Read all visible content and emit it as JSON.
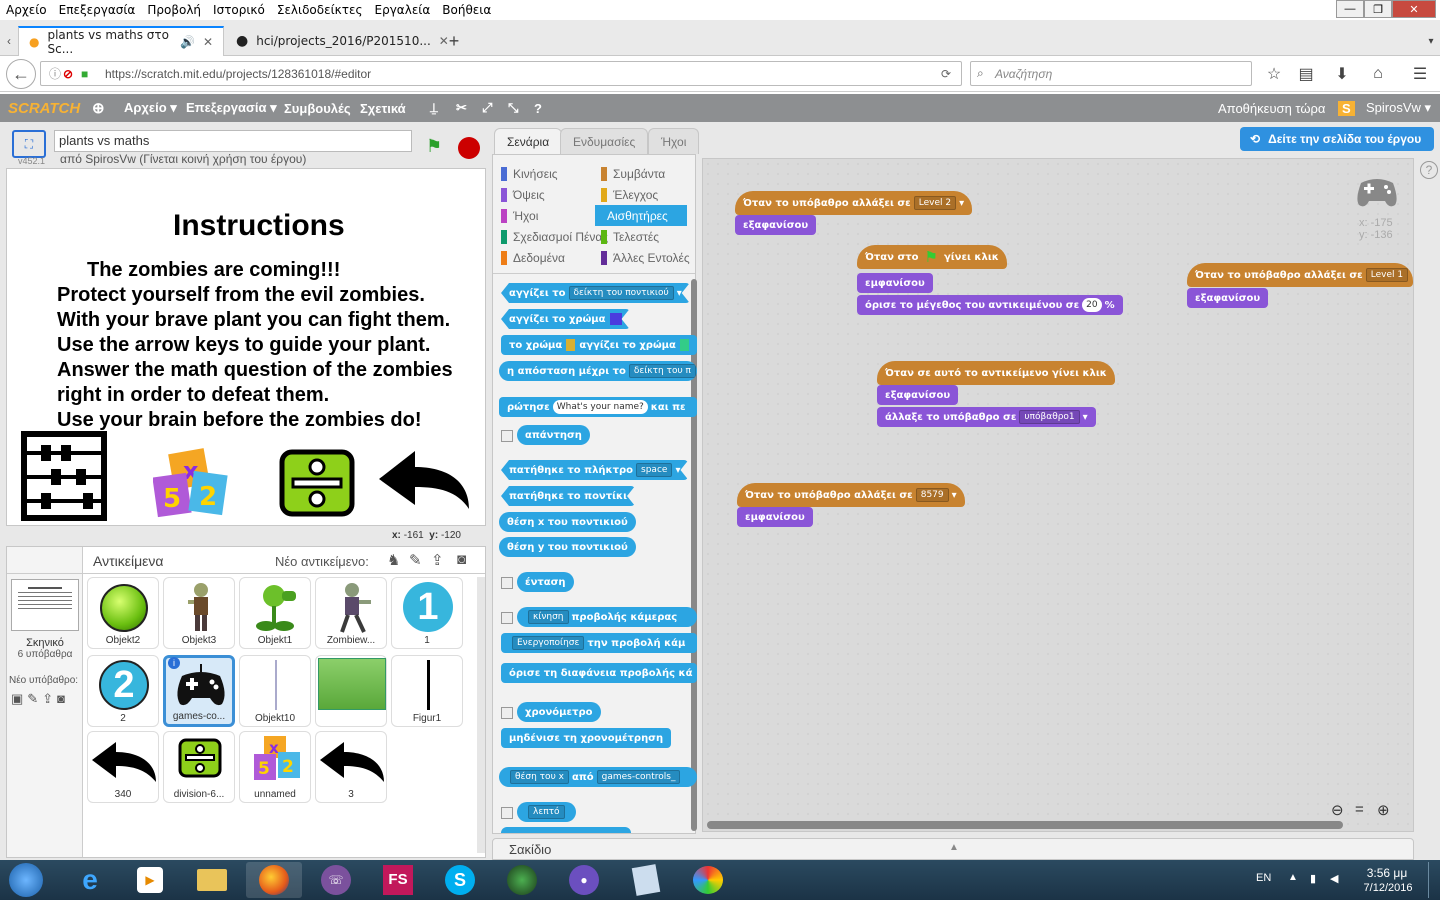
{
  "browser": {
    "menu": [
      "Αρχείο",
      "Επεξεργασία",
      "Προβολή",
      "Ιστορικό",
      "Σελιδοδείκτες",
      "Εργαλεία",
      "Βοήθεια"
    ],
    "tabs": [
      {
        "title": "plants vs maths στο Sc..."
      },
      {
        "title": "hci/projects_2016/P201510..."
      }
    ],
    "url": "https://scratch.mit.edu/projects/128361018/#editor",
    "search_placeholder": "Αναζήτηση"
  },
  "scratch": {
    "logo": "SCRATCH",
    "menu": [
      "Αρχείο ▾",
      "Επεξεργασία ▾",
      "Συμβουλές",
      "Σχετικά"
    ],
    "save_now": "Αποθήκευση τώρα",
    "user": "SpirosVw ▾",
    "see_page": "Δείτε την σελίδα του έργου",
    "project_title": "plants vs maths",
    "project_by": "από SpirosVw (Γίνεται κοινή χρήση του έργου)",
    "version": "v452.1",
    "stage_coords": {
      "x_label": "x:",
      "x": "-161",
      "y_label": "y:",
      "y": "-120"
    },
    "stage": {
      "heading": "Instructions",
      "lines": [
        "The zombies are coming!!!",
        "Protect yourself  from the evil zombies.",
        "With your brave plant you can fight them.",
        "Use the arrow keys to guide your plant.",
        "Answer the math question of the zombies",
        "right in order to defeat them.",
        "Use your brain before the zombies do!"
      ]
    },
    "sprites_header": "Αντικείμενα",
    "new_sprite": "Νέο αντικείμενο:",
    "stage_thumb": {
      "label": "Σκηνικό",
      "sub": "6 υπόβαθρα"
    },
    "new_backdrop": "Νέο υπόβαθρο:",
    "sprites": [
      "Objekt2",
      "Objekt3",
      "Objekt1",
      "Zombiew...",
      "1",
      "2",
      "games-co...",
      "Objekt10",
      "",
      "Figur1",
      "340",
      "division-6...",
      "unnamed",
      "3"
    ],
    "editor_tabs": [
      "Σενάρια",
      "Ενδυμασίες",
      "Ήχοι"
    ],
    "categories_left": [
      "Κινήσεις",
      "Όψεις",
      "Ήχοι",
      "Σχεδιασμοί Πένας",
      "Δεδομένα"
    ],
    "categories_right": [
      "Συμβάντα",
      "Έλεγχος",
      "Αισθητήρες",
      "Τελεστές",
      "Άλλες Εντολές"
    ],
    "palette_blocks": {
      "touching": "αγγίζει το",
      "mouse_pointer": "δείκτη του ποντικιού",
      "touching_color": "αγγίζει το χρώμα",
      "color": "το χρώμα",
      "touches_color": "αγγίζει το χρώμα",
      "distance": "η απόσταση μέχρι το",
      "distance_target": "δείκτη του π",
      "ask": "ρώτησε",
      "ask_default": "What's your name?",
      "and_wait": "και πε",
      "answer": "απάντηση",
      "key_pressed": "πατήθηκε το πλήκτρο",
      "key": "space",
      "mouse_down": "πατήθηκε το ποντίκι",
      "mouse_x": "θέση x του ποντικιού",
      "mouse_y": "θέση y του ποντικιού",
      "loudness": "ένταση",
      "video_motion": "κίνηση",
      "video_on": "προβολής κάμερας",
      "turn_video": "Ενεργοποίησε",
      "video_view": "την προβολή κάμ",
      "set_transparency": "όρισε τη διαφάνεια προβολής κά",
      "timer": "χρονόμετρο",
      "reset_timer": "μηδένισε τη χρονομέτρηση",
      "of_attr": "θέση του x",
      "of_word": "από",
      "of_target": "games-controls_",
      "current_minute": "λεπτό"
    },
    "sprite_xy": {
      "x_label": "x:",
      "x": "-175",
      "y_label": "y:",
      "y": "-136"
    },
    "scripts": {
      "s1_hat": "Όταν το υπόβαθρο αλλάξει σε",
      "s1_val": "Level 2",
      "s1_b1": "εξαφανίσου",
      "s2_hat_a": "Όταν στο",
      "s2_hat_b": "γίνει κλικ",
      "s2_b1": "εμφανίσου",
      "s2_b2": "όρισε το μέγεθος του αντικειμένου σε",
      "s2_b2_val": "20",
      "s2_b2_unit": "%",
      "s3_hat": "Όταν το υπόβαθρο αλλάξει σε",
      "s3_val": "Level 1",
      "s3_b1": "εξαφανίσου",
      "s4_hat": "Όταν σε αυτό το αντικείμενο γίνει κλικ",
      "s4_b1": "εξαφανίσου",
      "s4_b2": "άλλαξε το υπόβαθρο σε",
      "s4_b2_val": "υπόβαθρο1",
      "s5_hat": "Όταν το υπόβαθρο αλλάξει σε",
      "s5_val": "8579",
      "s5_b1": "εμφανίσου"
    },
    "backpack": "Σακίδιο"
  },
  "taskbar": {
    "lang": "EN",
    "time": "3:56 μμ",
    "date": "7/12/2016"
  }
}
